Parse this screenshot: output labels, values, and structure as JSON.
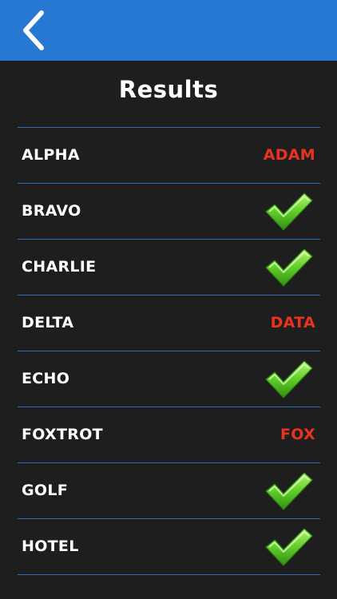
{
  "header": {
    "back_icon": "chevron-left-icon",
    "accent_color": "#2778d2"
  },
  "page": {
    "title": "Results"
  },
  "results": [
    {
      "label": "ALPHA",
      "correct": false,
      "answer": "ADAM"
    },
    {
      "label": "BRAVO",
      "correct": true,
      "answer": ""
    },
    {
      "label": "CHARLIE",
      "correct": true,
      "answer": ""
    },
    {
      "label": "DELTA",
      "correct": false,
      "answer": "DATA"
    },
    {
      "label": "ECHO",
      "correct": true,
      "answer": ""
    },
    {
      "label": "FOXTROT",
      "correct": false,
      "answer": "FOX"
    },
    {
      "label": "GOLF",
      "correct": true,
      "answer": ""
    },
    {
      "label": "HOTEL",
      "correct": true,
      "answer": ""
    }
  ],
  "colors": {
    "wrong_answer": "#e8331f",
    "check": "#5fcf2a",
    "divider": "#2e6db5",
    "background": "#1e1e1e"
  },
  "icons": {
    "correct": "checkmark-icon"
  }
}
